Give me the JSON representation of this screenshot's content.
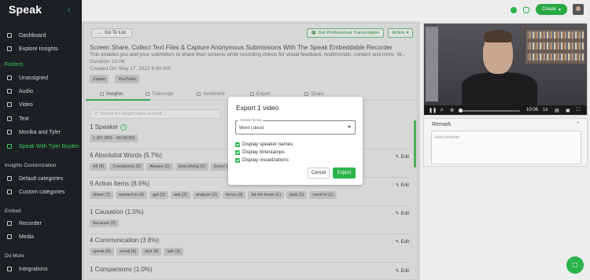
{
  "sidebar": {
    "logo": "Speak",
    "items": [
      {
        "label": "Dashboard"
      },
      {
        "label": "Explore Insights"
      }
    ],
    "folders_label": "Folders",
    "folders": [
      {
        "label": "Unassigned"
      },
      {
        "label": "Audio"
      },
      {
        "label": "Video"
      },
      {
        "label": "Text"
      },
      {
        "label": "Monika and Tyler"
      },
      {
        "label": "Speak With Tyler Bryden"
      }
    ],
    "insights_customization_label": "Insights Customization",
    "customization": [
      {
        "label": "Default categories"
      },
      {
        "label": "Custom categories"
      }
    ],
    "embed_label": "Embed",
    "embed": [
      {
        "label": "Recorder"
      },
      {
        "label": "Media"
      }
    ],
    "do_more_label": "Do More",
    "do_more": [
      {
        "label": "Integrations"
      }
    ]
  },
  "topbar": {
    "create_label": "Create",
    "accent": "#27a843"
  },
  "main": {
    "goto_label": "Go To List",
    "pro_transcription_label": "Get Professional Transcription",
    "action_label": "Action",
    "title": "Screen Share, Collect Text Files & Capture Anonymous Submissions With The Speak Embeddable Recorder",
    "description": "This enables you and your submitters to share their screens while recording videos for visual feedback, testimonials, content and more. W...",
    "duration": "Duration: 10:06",
    "created": "Created On: May 17, 2022 9:40 AM",
    "tags": [
      "Zapier",
      "YouTube"
    ],
    "tabs": [
      {
        "label": "Insights"
      },
      {
        "label": "Transcript"
      },
      {
        "label": "Sentiment"
      },
      {
        "label": "Export"
      },
      {
        "label": "Share"
      }
    ],
    "search_placeholder": "Search for Insight name or word...",
    "edit_label": "Edit",
    "sections": [
      {
        "title": "1 Speaker",
        "chips": [
          "1 (97.36% - 00:09:50)"
        ]
      },
      {
        "title": "6 Absolutist Words (5.7%)",
        "chips": [
          "All (9)",
          "Completely (2)",
          "Always (2)",
          "Everything (1)",
          "Every (1)"
        ]
      },
      {
        "title": "9 Action Items (8.6%)",
        "chips": [
          "share (7)",
          "wanted to (4)",
          "get (3)",
          "ask (2)",
          "analyze (2)",
          "focus (2)",
          "let me know (1)",
          "task (1)",
          "need to (1)"
        ]
      },
      {
        "title": "1 Causation (1.0%)",
        "chips": [
          "because (3)"
        ]
      },
      {
        "title": "4 Communication (3.8%)",
        "chips": [
          "speak (6)",
          "email (6)",
          "text (4)",
          "talk (3)"
        ]
      },
      {
        "title": "1 Comparisons (1.0%)",
        "chips": []
      }
    ]
  },
  "modal": {
    "title": "Export 1 video",
    "format_legend": "Choose format",
    "format_value": "Word (.docx)",
    "options": [
      {
        "label": "Display speaker names",
        "checked": true
      },
      {
        "label": "Display timestamps",
        "checked": true
      },
      {
        "label": "Display visualizations",
        "checked": true
      }
    ],
    "cancel_label": "Cancel",
    "export_label": "Export"
  },
  "video": {
    "time": "10:06",
    "speed": "1x"
  },
  "remark": {
    "title": "Remark",
    "placeholder": "Add remarks"
  }
}
